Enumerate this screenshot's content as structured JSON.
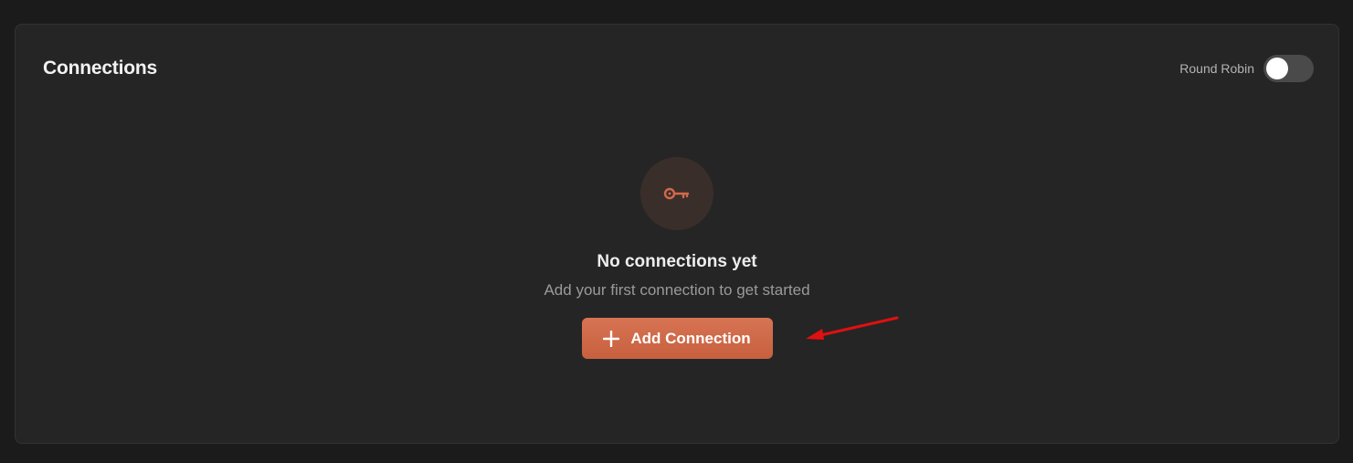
{
  "panel": {
    "title": "Connections",
    "round_robin": {
      "label": "Round Robin",
      "enabled": false
    }
  },
  "empty_state": {
    "icon": "key-icon",
    "title": "No connections yet",
    "subtitle": "Add your first connection to get started",
    "button": {
      "icon": "plus-icon",
      "label": "Add Connection"
    }
  },
  "annotation": {
    "icon": "red-arrow-icon",
    "color": "#e01010"
  },
  "colors": {
    "accent": "#d06a4a",
    "background": "#1b1b1b",
    "panel": "#252525"
  }
}
